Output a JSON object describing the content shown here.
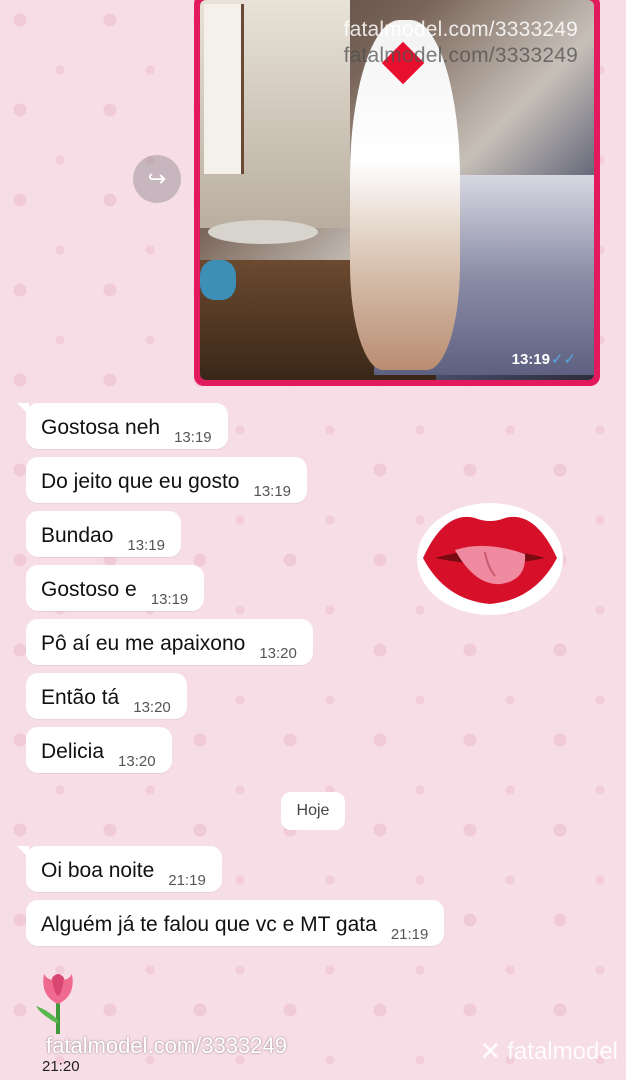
{
  "image_message": {
    "watermark_line1": "fatalmodel.com/3333249",
    "watermark_line2": "fatalmodel.com/3333249",
    "time": "13:19",
    "ticks": "✓✓"
  },
  "forward_icon": "↪",
  "messages": [
    {
      "text": "Gostosa neh",
      "time": "13:19"
    },
    {
      "text": "Do jeito que eu gosto",
      "time": "13:19"
    },
    {
      "text": "Bundao",
      "time": "13:19"
    },
    {
      "text": "Gostoso e",
      "time": "13:19"
    },
    {
      "text": "Pô aí eu me apaixono",
      "time": "13:20"
    },
    {
      "text": "Então tá",
      "time": "13:20"
    },
    {
      "text": "Delicia",
      "time": "13:20"
    }
  ],
  "date_chip": "Hoje",
  "messages_today": [
    {
      "text": "Oi boa noite",
      "time": "21:19"
    },
    {
      "text": "Alguém já te falou que vc e MT gata",
      "time": "21:19"
    }
  ],
  "sticker": "lips-sticker",
  "tulip_message": {
    "watermark": "fatalmodel.com/3333249",
    "time": "21:20"
  },
  "brand": {
    "name": "fatalmodel",
    "icon": "✕"
  },
  "colors": {
    "background": "#f7dde6",
    "image_border": "#e2195d",
    "bubble": "#ffffff",
    "read_ticks": "#5aa9e6"
  }
}
